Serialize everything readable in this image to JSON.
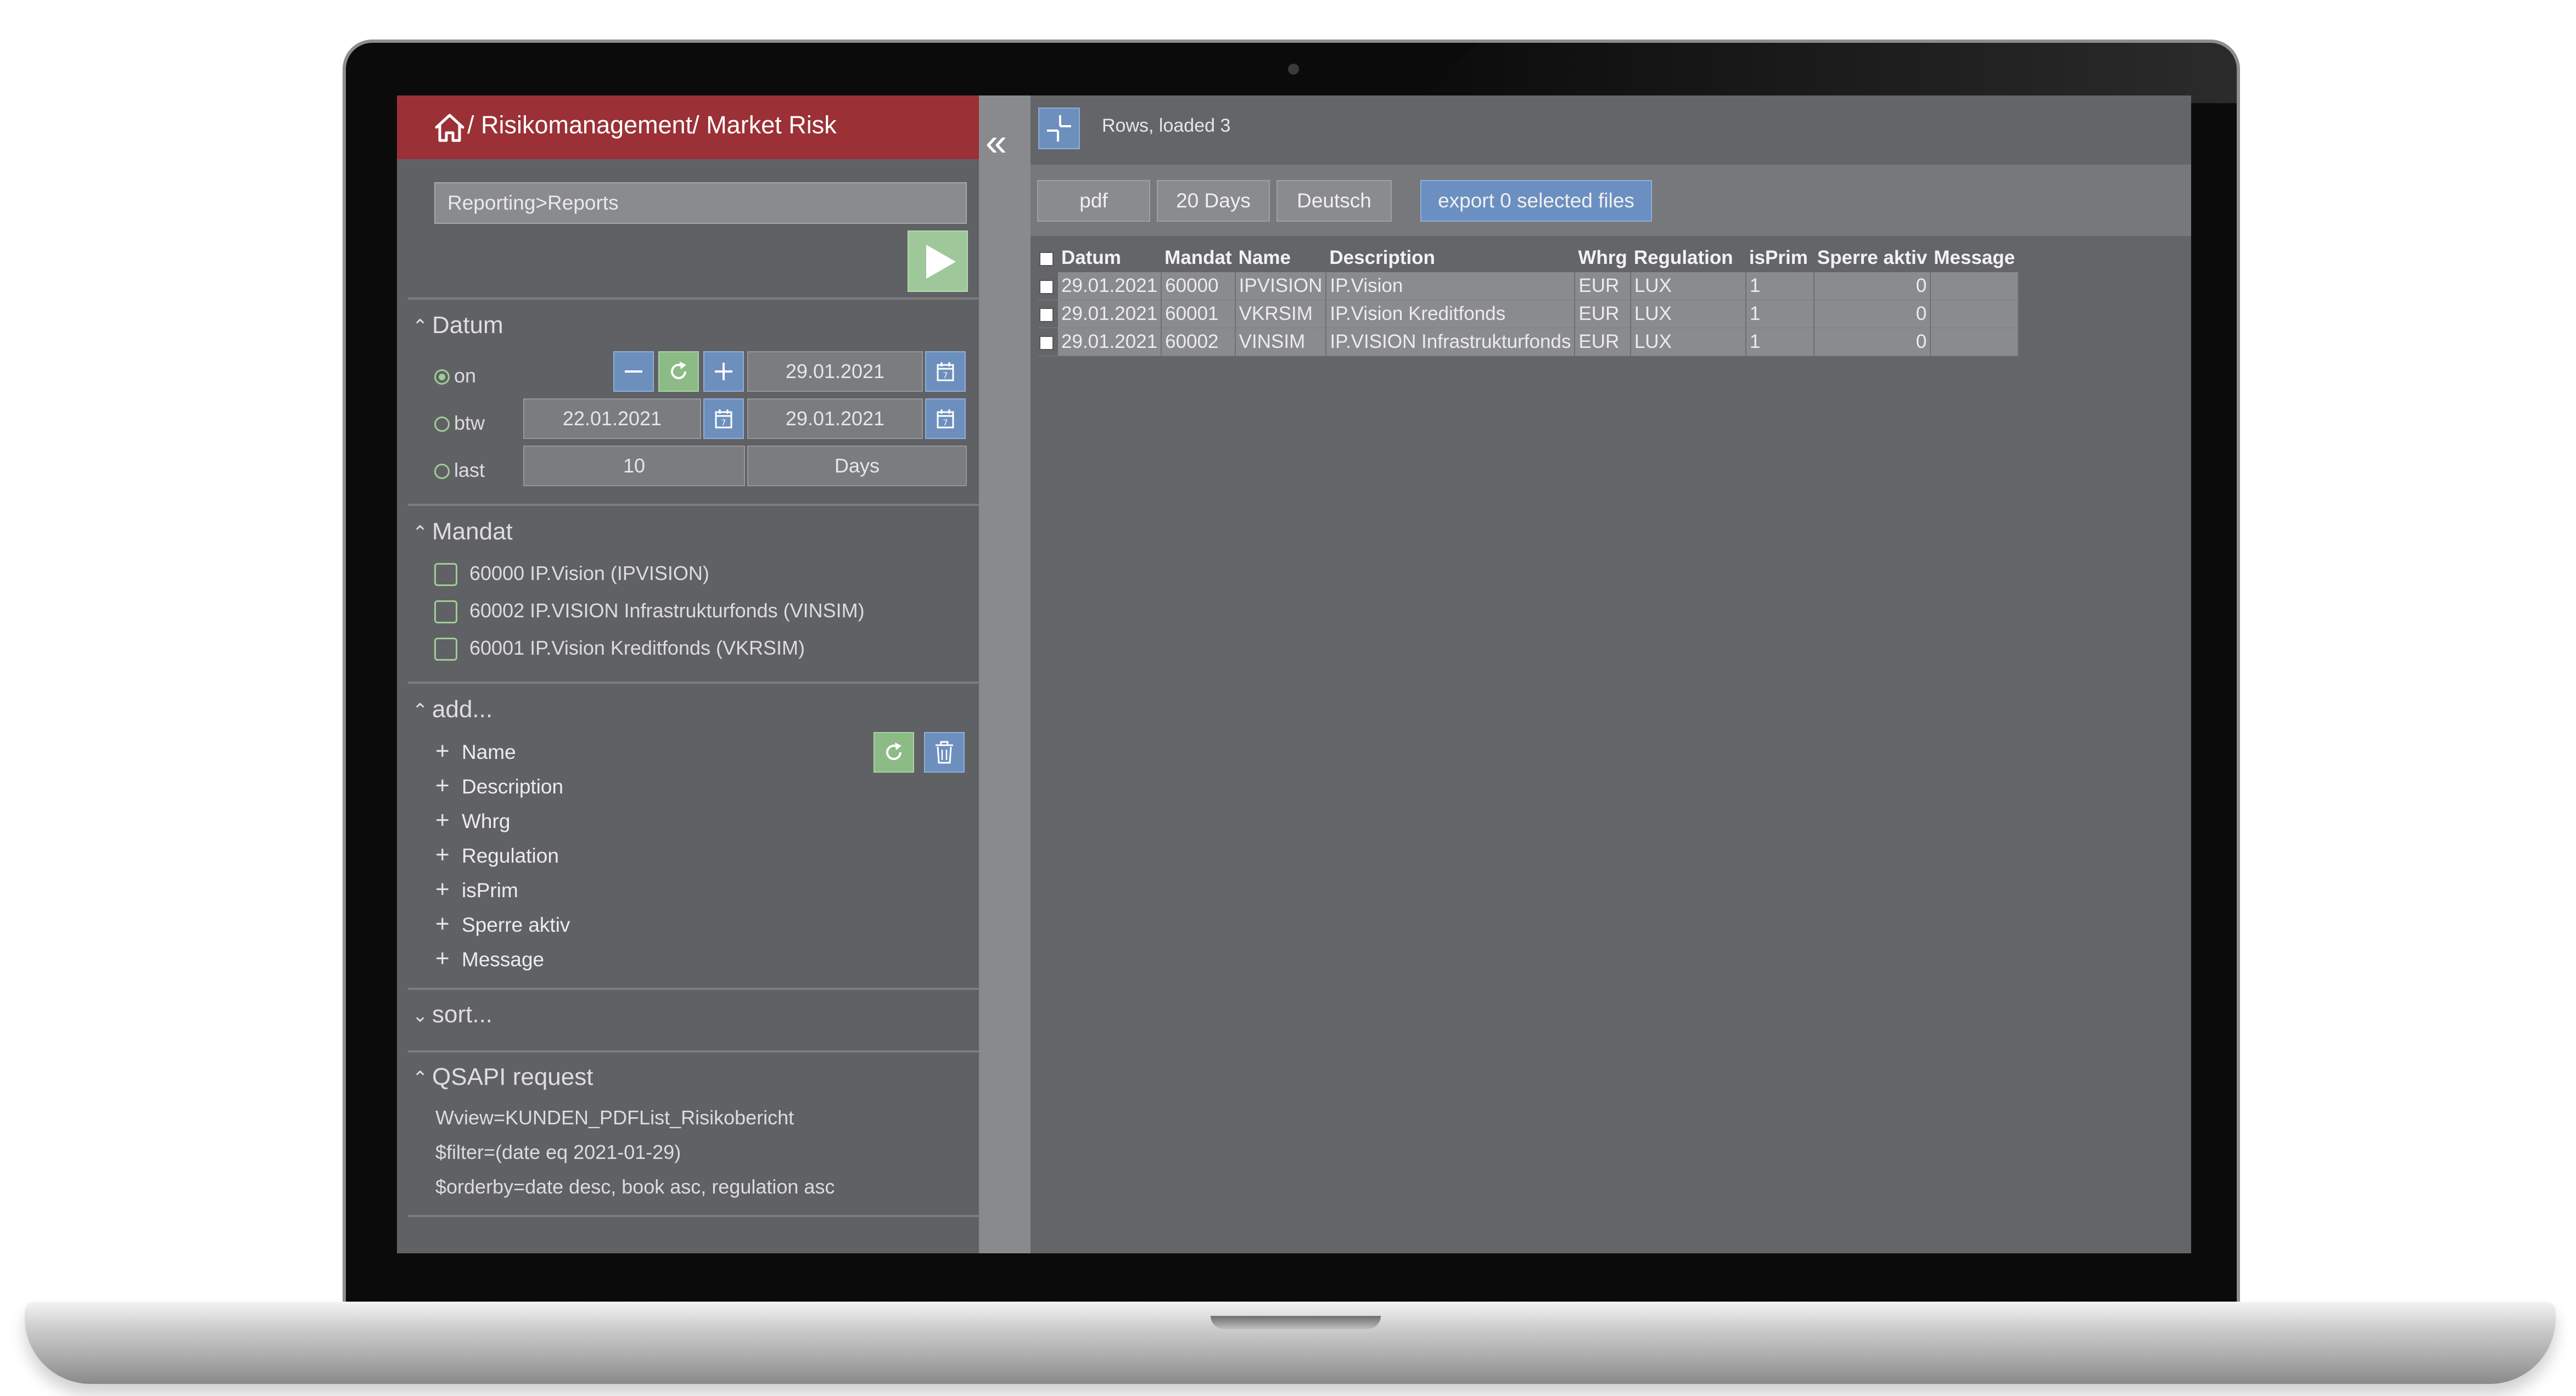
{
  "header": {
    "title": "/ Risikomanagement/ Market Risk"
  },
  "report_path": "Reporting>Reports",
  "datum": {
    "section_label": "Datum",
    "on": {
      "label": "on",
      "date": "29.01.2021"
    },
    "btw": {
      "label": "btw",
      "from": "22.01.2021",
      "to": "29.01.2021"
    },
    "last": {
      "label": "last",
      "count": "10",
      "unit": "Days"
    }
  },
  "mandat": {
    "section_label": "Mandat",
    "items": [
      "60000 IP.Vision (IPVISION)",
      "60002 IP.VISION Infrastrukturfonds (VINSIM)",
      "60001 IP.Vision Kreditfonds (VKRSIM)"
    ]
  },
  "add": {
    "section_label": "add...",
    "items": [
      "Name",
      "Description",
      "Whrg",
      "Regulation",
      "isPrim",
      "Sperre aktiv",
      "Message"
    ]
  },
  "sort": {
    "section_label": "sort..."
  },
  "qsapi": {
    "section_label": "QSAPI request",
    "lines": [
      "Wview=KUNDEN_PDFList_Risikobericht",
      "$filter=(date eq 2021-01-29)",
      "$orderby=date desc, book asc, regulation asc"
    ]
  },
  "right": {
    "rows_status": "Rows, loaded 3",
    "toolbar": {
      "pdf": "pdf",
      "days": "20 Days",
      "language": "Deutsch",
      "export": "export 0 selected files"
    },
    "table": {
      "columns": [
        "Datum",
        "Mandat",
        "Name",
        "Description",
        "Whrg",
        "Regulation",
        "isPrim",
        "Sperre aktiv",
        "Message"
      ],
      "rows": [
        [
          "29.01.2021",
          "60000",
          "IPVISION",
          "IP.Vision",
          "EUR",
          "LUX",
          "1",
          "0",
          ""
        ],
        [
          "29.01.2021",
          "60001",
          "VKRSIM",
          "IP.Vision Kreditfonds",
          "EUR",
          "LUX",
          "1",
          "0",
          ""
        ],
        [
          "29.01.2021",
          "60002",
          "VINSIM",
          "IP.VISION Infrastrukturfonds",
          "EUR",
          "LUX",
          "1",
          "0",
          ""
        ]
      ]
    }
  },
  "colors": {
    "header_red": "#9b3037",
    "accent_blue": "#6c8fbd",
    "accent_green": "#8cbb86",
    "panel_gray": "#606165"
  }
}
